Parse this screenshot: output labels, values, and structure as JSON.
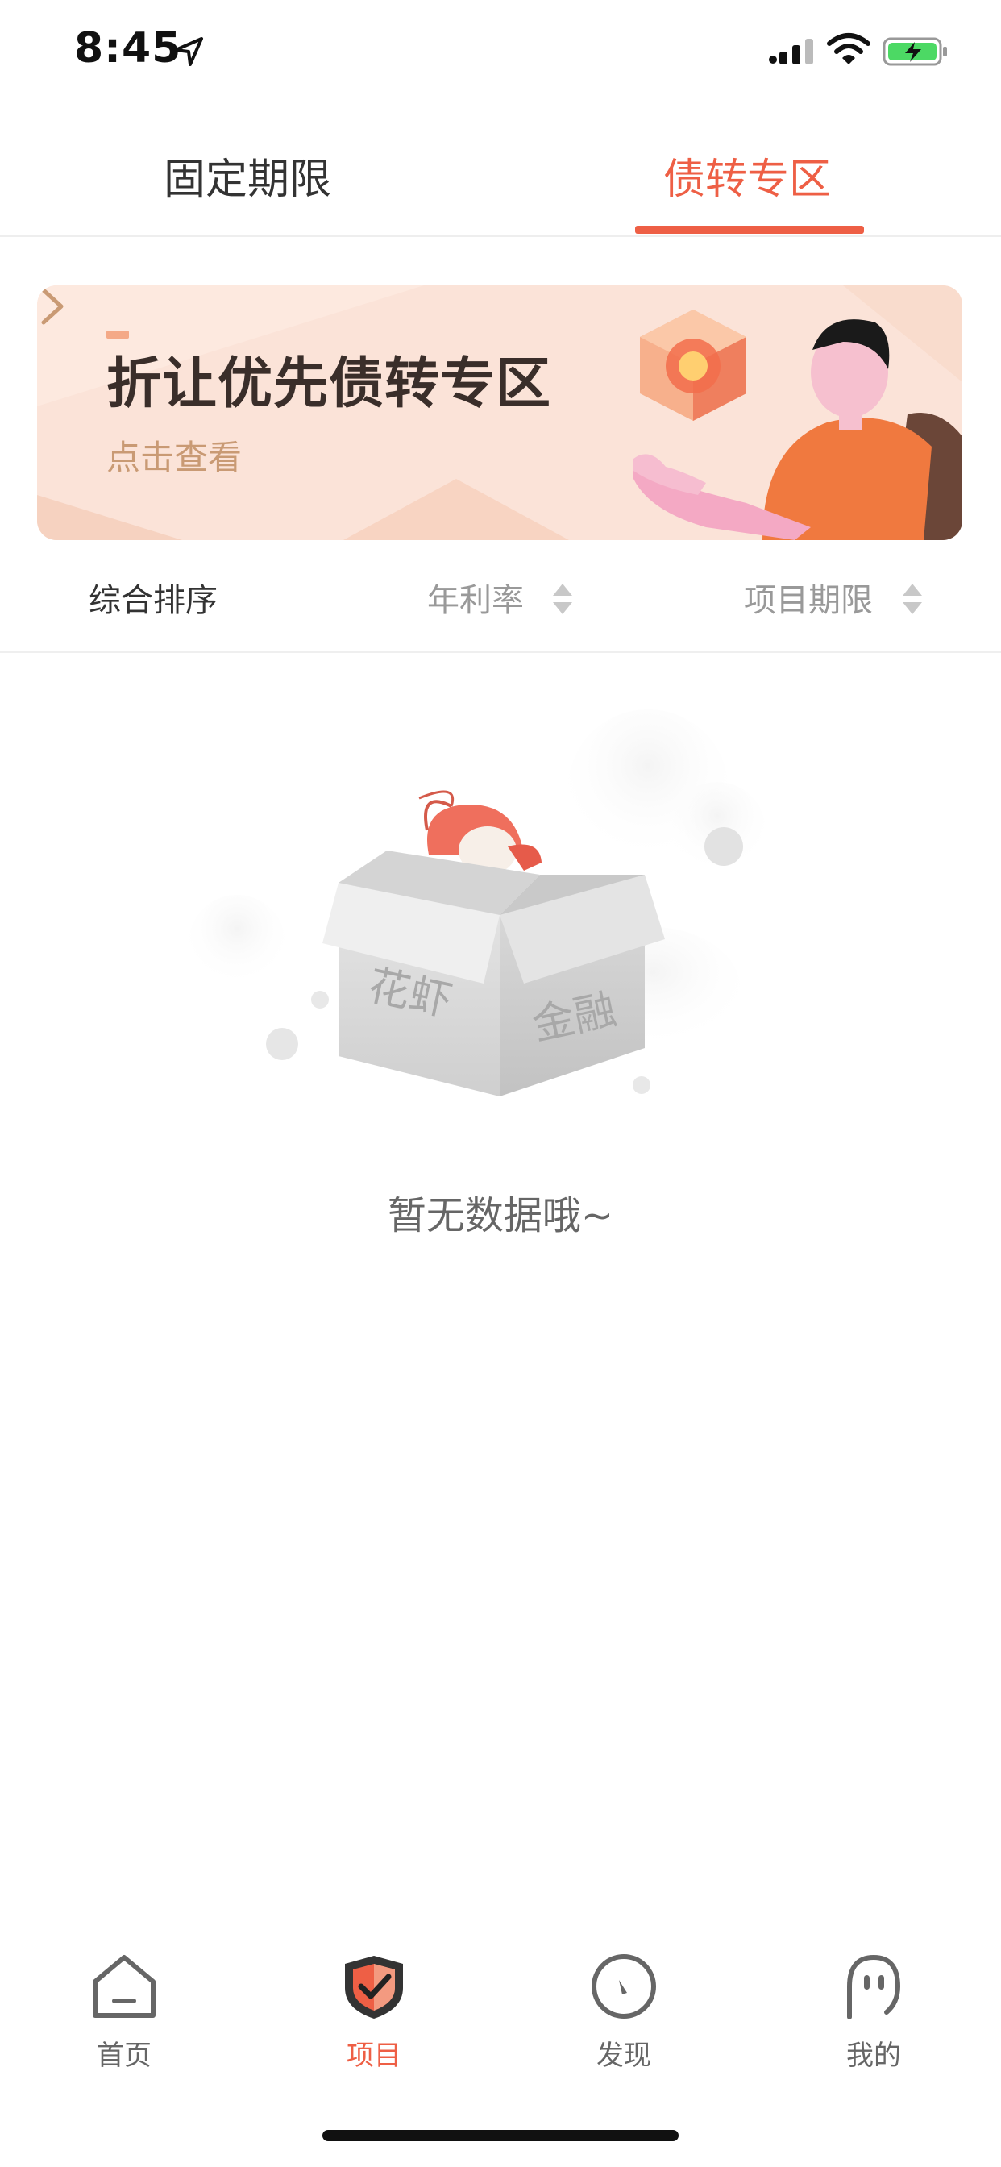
{
  "status_bar": {
    "time": "8:45"
  },
  "tabs": [
    {
      "label": "固定期限",
      "active": false
    },
    {
      "label": "债转专区",
      "active": true
    }
  ],
  "banner": {
    "title": "折让优先债转专区",
    "link": "点击查看"
  },
  "sort": {
    "comprehensive": "综合排序",
    "rate": "年利率",
    "term": "项目期限"
  },
  "empty": {
    "text": "暂无数据哦~",
    "box_text_left": "花虾",
    "box_text_right": "金融"
  },
  "nav": [
    {
      "label": "首页",
      "icon": "home-icon"
    },
    {
      "label": "项目",
      "icon": "shield-check-icon"
    },
    {
      "label": "发现",
      "icon": "compass-icon"
    },
    {
      "label": "我的",
      "icon": "ghost-face-icon"
    }
  ],
  "colors": {
    "accent": "#ee5f45",
    "banner_bg": "#fbe3d8"
  }
}
